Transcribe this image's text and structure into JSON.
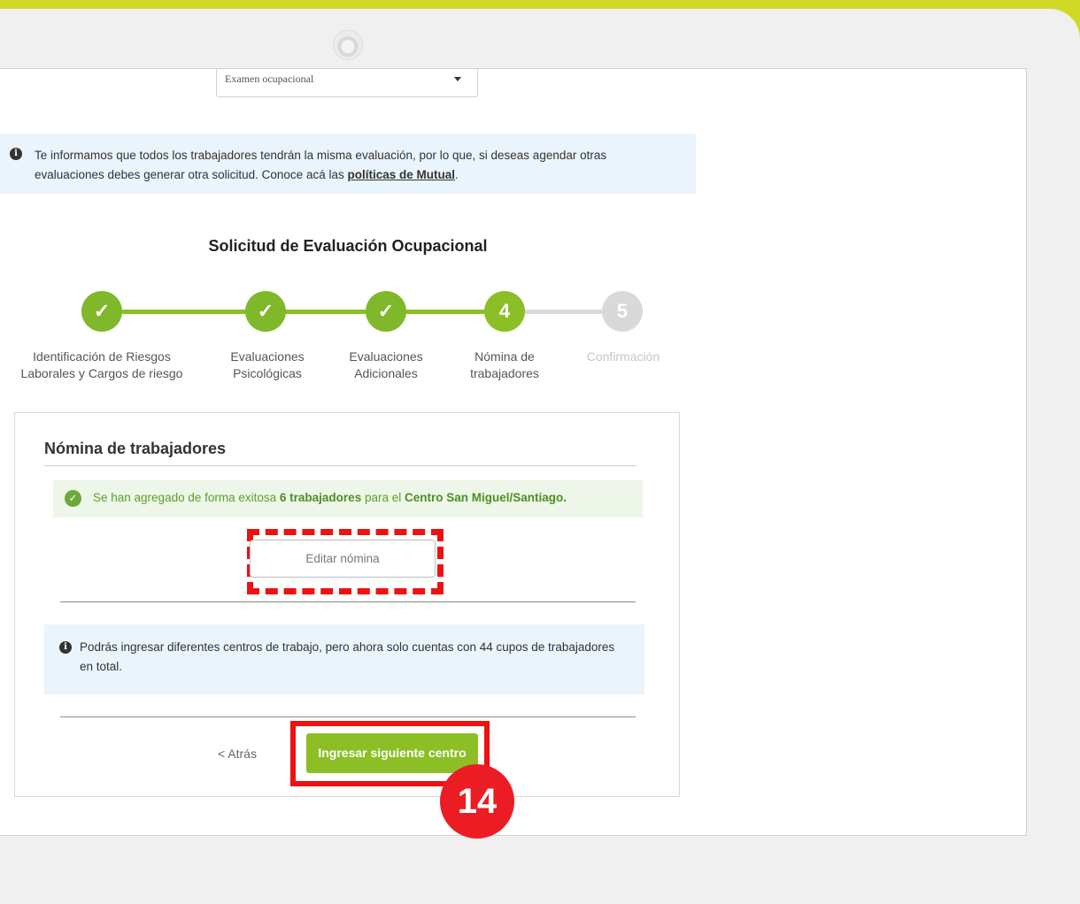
{
  "select": {
    "value": "Examen ocupacional"
  },
  "info_top": {
    "text": "Te informamos que todos los trabajadores tendrán la misma evaluación, por lo que, si deseas agendar otras evaluaciones debes generar otra solicitud. Conoce acá las ",
    "link": "políticas de Mutual",
    "end": "."
  },
  "form_title": "Solicitud de Evaluación Ocupacional",
  "steps": [
    {
      "number": "1",
      "label_line1": "Identificación de Riesgos",
      "label_line2": "Laborales y Cargos de riesgo",
      "status": "done"
    },
    {
      "number": "2",
      "label_line1": "Evaluaciones",
      "label_line2": "Psicológicas",
      "status": "done"
    },
    {
      "number": "3",
      "label_line1": "Evaluaciones",
      "label_line2": "Adicionales",
      "status": "done"
    },
    {
      "number": "4",
      "label_line1": "Nómina de",
      "label_line2": "trabajadores",
      "status": "current"
    },
    {
      "number": "5",
      "label_line1": "Confirmación",
      "label_line2": "",
      "status": "pending"
    }
  ],
  "card": {
    "title": "Nómina de trabajadores",
    "success": {
      "prefix": "Se han agregado de forma exitosa ",
      "count": "6 trabajadores",
      "middle": " para el ",
      "center": "Centro San Miguel/Santiago."
    },
    "edit_button": "Editar nómina",
    "info": "Podrás ingresar diferentes centros de trabajo, pero ahora solo cuentas con 44 cupos de trabajadores en total.",
    "back": "< Atrás",
    "next_button": "Ingresar siguiente centro"
  },
  "annotation": {
    "step_number": "14"
  },
  "colors": {
    "accent_green": "#8cbf26",
    "brand_lime": "#cfd928",
    "highlight_red": "#ee1111",
    "info_bg": "#eaf4fc",
    "step_pending": "#d9d9d9"
  }
}
